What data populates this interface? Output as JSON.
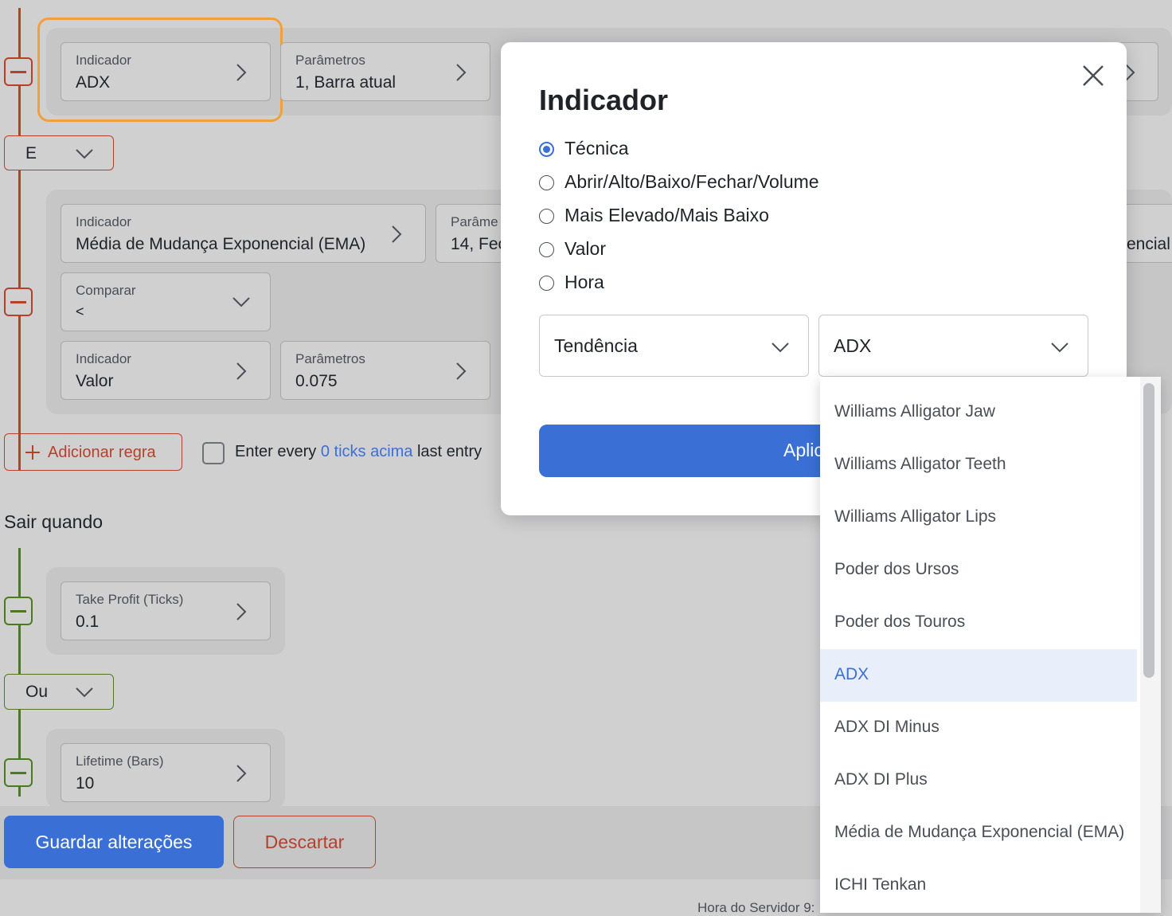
{
  "entry_rules": {
    "group1": {
      "indicator": {
        "label": "Indicador",
        "value": "ADX"
      },
      "params": {
        "label": "Parâmetros",
        "value": "1, Barra atual"
      }
    },
    "logic_operator": "E",
    "group2": {
      "indicator": {
        "label": "Indicador",
        "value": "Média de Mudança Exponencial (EMA)"
      },
      "params": {
        "label": "Parâme",
        "value": "14, Fec"
      },
      "cut_value": "encial",
      "compare": {
        "label": "Comparar",
        "value": "<"
      },
      "indicator2": {
        "label": "Indicador",
        "value": "Valor"
      },
      "params2": {
        "label": "Parâmetros",
        "value": "0.075"
      }
    },
    "add_rule_label": "Adicionar regra",
    "enter_every": {
      "prefix": "Enter every",
      "link": "0 ticks acima",
      "suffix": "last entry"
    }
  },
  "exit_rules": {
    "title": "Sair quando",
    "take_profit": {
      "label": "Take Profit (Ticks)",
      "value": "0.1"
    },
    "logic_operator": "Ou",
    "lifetime": {
      "label": "Lifetime (Bars)",
      "value": "10"
    }
  },
  "footer": {
    "save_label": "Guardar alterações",
    "discard_label": "Descartar",
    "server_time": "Hora do Servidor 9:"
  },
  "modal": {
    "title": "Indicador",
    "radio_options": [
      {
        "label": "Técnica",
        "checked": true
      },
      {
        "label": "Abrir/Alto/Baixo/Fechar/Volume",
        "checked": false
      },
      {
        "label": "Mais Elevado/Mais Baixo",
        "checked": false
      },
      {
        "label": "Valor",
        "checked": false
      },
      {
        "label": "Hora",
        "checked": false
      }
    ],
    "category_select": "Tendência",
    "indicator_select": "ADX",
    "apply_label": "Aplic"
  },
  "dropdown": {
    "items": [
      "Williams Alligator Jaw",
      "Williams Alligator Teeth",
      "Williams Alligator Lips",
      "Poder dos Ursos",
      "Poder dos Touros",
      "ADX",
      "ADX DI Minus",
      "ADX DI Plus",
      "Média de Mudança Exponencial (EMA)",
      "ICHI Tenkan"
    ],
    "selected": "ADX"
  },
  "colors": {
    "accent": "#3a6fd6",
    "entry_line": "#b5412a",
    "exit_line": "#4c7a1f",
    "highlight_outline": "#f0a03c"
  }
}
